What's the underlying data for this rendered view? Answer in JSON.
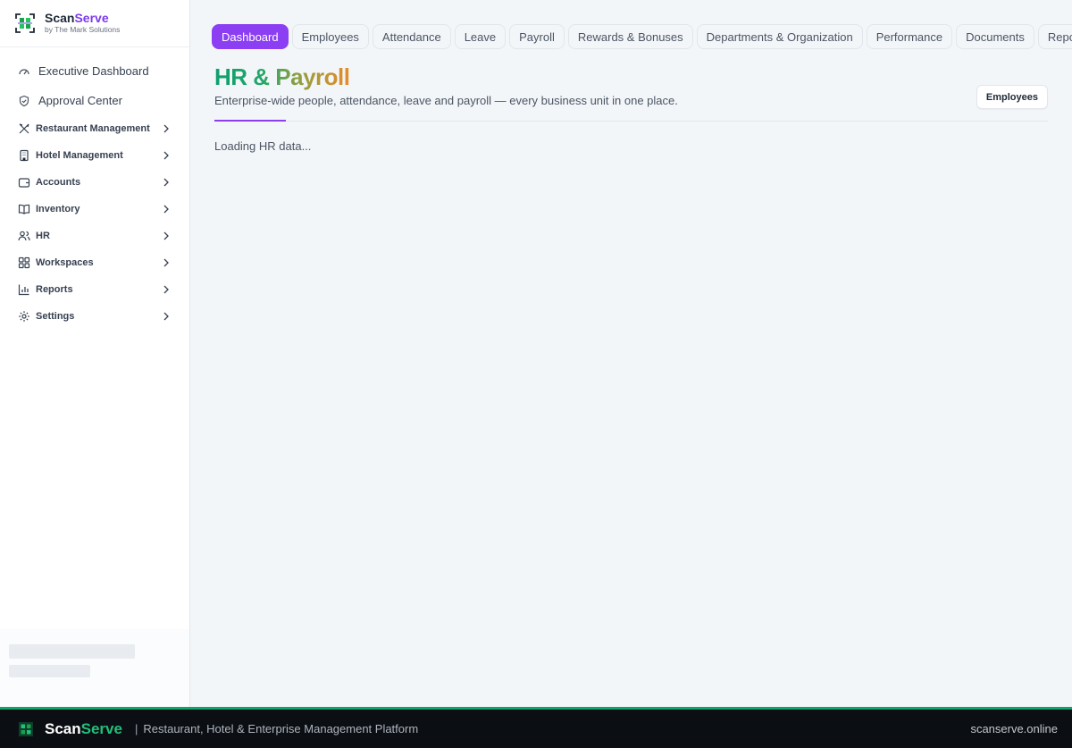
{
  "brand": {
    "name_part1": "Scan",
    "name_part2": "Serve",
    "subtitle": "by The Mark Solutions"
  },
  "sidebar": {
    "top_items": [
      {
        "label": "Executive Dashboard",
        "icon": "gauge-icon"
      },
      {
        "label": "Approval Center",
        "icon": "shield-check-icon"
      }
    ],
    "groups": [
      {
        "label": "Restaurant Management",
        "icon": "utensils-icon"
      },
      {
        "label": "Hotel Management",
        "icon": "building-icon"
      },
      {
        "label": "Accounts",
        "icon": "wallet-icon"
      },
      {
        "label": "Inventory",
        "icon": "book-icon"
      },
      {
        "label": "HR",
        "icon": "users-icon"
      },
      {
        "label": "Workspaces",
        "icon": "grid-icon"
      },
      {
        "label": "Reports",
        "icon": "bar-chart-icon"
      },
      {
        "label": "Settings",
        "icon": "gear-icon"
      }
    ]
  },
  "tabs": [
    {
      "label": "Dashboard",
      "active": true
    },
    {
      "label": "Employees"
    },
    {
      "label": "Attendance"
    },
    {
      "label": "Leave"
    },
    {
      "label": "Payroll"
    },
    {
      "label": "Rewards & Bonuses"
    },
    {
      "label": "Departments & Organization"
    },
    {
      "label": "Performance"
    },
    {
      "label": "Documents"
    },
    {
      "label": "Reports"
    }
  ],
  "page": {
    "title": "HR & Payroll",
    "subtitle": "Enterprise-wide people, attendance, leave and payroll — every business unit in one place.",
    "employees_button": "Employees",
    "loading_text": "Loading HR data..."
  },
  "footer": {
    "name_part1": "Scan",
    "name_part2": "Serve",
    "separator": "|",
    "tagline": "Restaurant, Hotel & Enterprise Management Platform",
    "domain": "scanserve.online"
  },
  "colors": {
    "accent": "#8b3ef2",
    "brand_green": "#10a36a",
    "footer_bg": "#0b0f14"
  }
}
